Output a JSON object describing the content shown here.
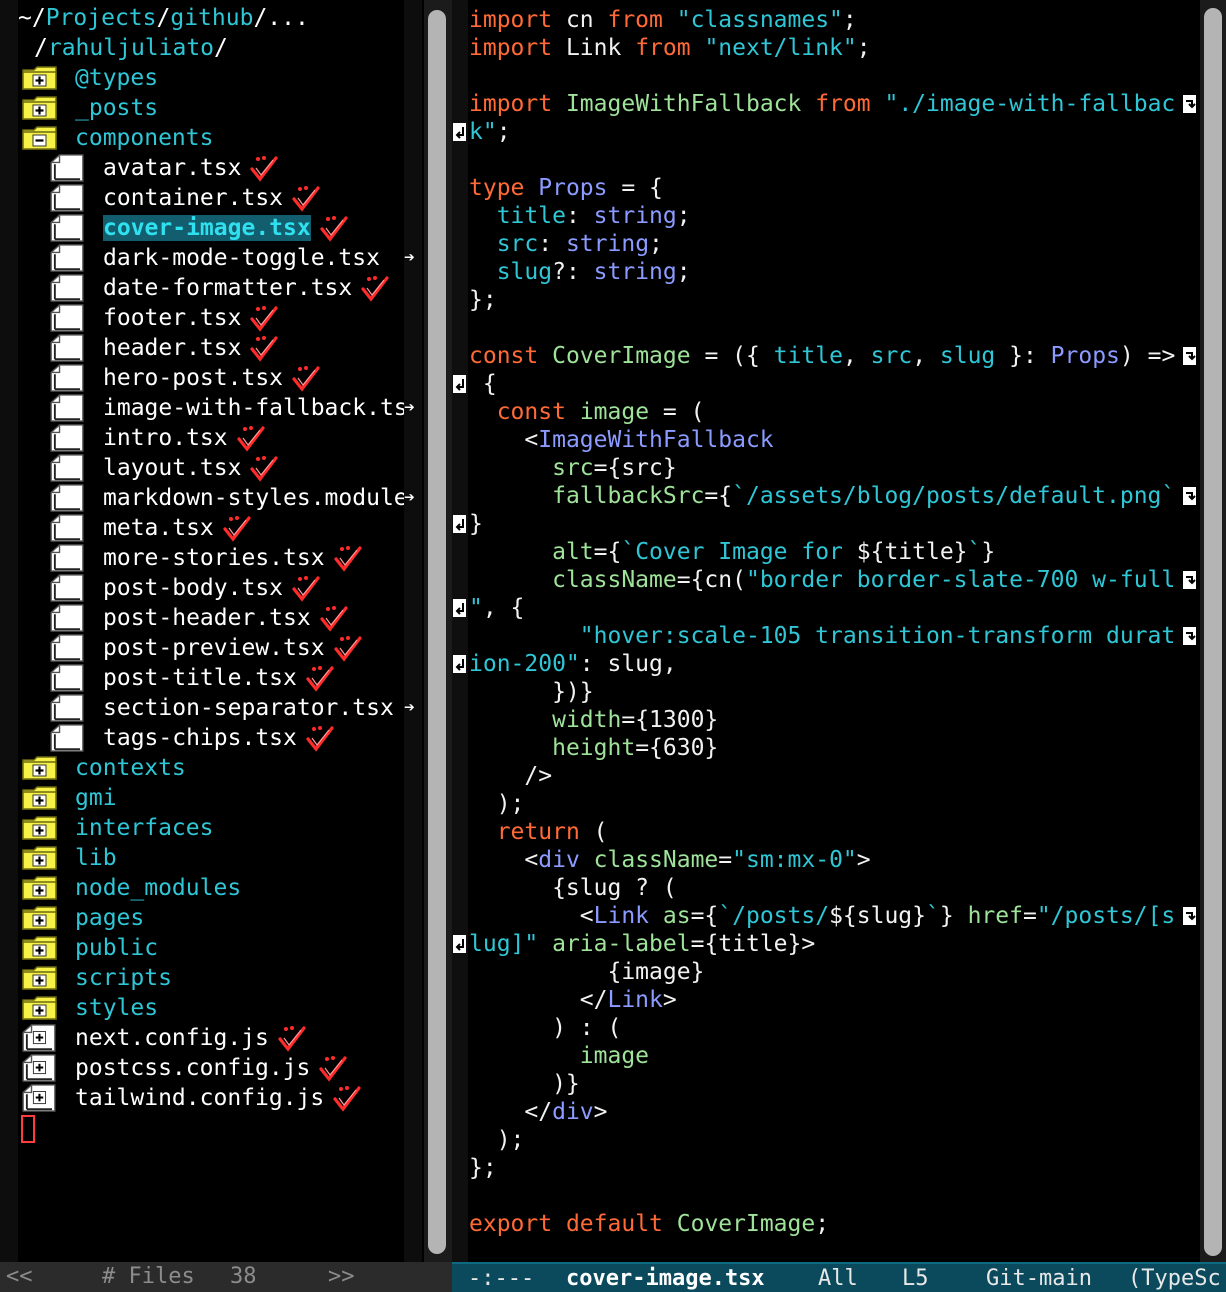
{
  "tree": {
    "path_line1": [
      "~/",
      "Projects",
      "/",
      "github",
      "/..."
    ],
    "path_line2": [
      "/",
      "rahuljuliato",
      "/"
    ],
    "top_dirs": [
      "@types",
      "_posts",
      "components"
    ],
    "component_files": [
      {
        "name": "avatar.tsx",
        "vc": true
      },
      {
        "name": "container.tsx",
        "vc": true
      },
      {
        "name": "cover-image.tsx",
        "vc": true,
        "selected": true
      },
      {
        "name": "dark-mode-toggle.tsx",
        "vc": false,
        "truncated": true
      },
      {
        "name": "date-formatter.tsx",
        "vc": true
      },
      {
        "name": "footer.tsx",
        "vc": true
      },
      {
        "name": "header.tsx",
        "vc": true
      },
      {
        "name": "hero-post.tsx",
        "vc": true
      },
      {
        "name": "image-with-fallback.ts",
        "vc": false,
        "truncated": true
      },
      {
        "name": "intro.tsx",
        "vc": true
      },
      {
        "name": "layout.tsx",
        "vc": true
      },
      {
        "name": "markdown-styles.module",
        "vc": false,
        "truncated": true
      },
      {
        "name": "meta.tsx",
        "vc": true
      },
      {
        "name": "more-stories.tsx",
        "vc": true
      },
      {
        "name": "post-body.tsx",
        "vc": true
      },
      {
        "name": "post-header.tsx",
        "vc": true
      },
      {
        "name": "post-preview.tsx",
        "vc": true
      },
      {
        "name": "post-title.tsx",
        "vc": true
      },
      {
        "name": "section-separator.tsx",
        "vc": false,
        "truncated": true
      },
      {
        "name": "tags-chips.tsx",
        "vc": true
      }
    ],
    "other_dirs": [
      "contexts",
      "gmi",
      "interfaces",
      "lib",
      "node_modules",
      "pages",
      "public",
      "scripts",
      "styles"
    ],
    "root_files": [
      "next.config.js",
      "postcss.config.js",
      "tailwind.config.js"
    ],
    "truncation_glyph": "➔"
  },
  "editor": {
    "lines": [
      [
        [
          "kw",
          "import"
        ],
        [
          "pn",
          " cn "
        ],
        [
          "kw",
          "from"
        ],
        [
          "pn",
          " "
        ],
        [
          "str",
          "\"classnames\""
        ],
        [
          "pn",
          ";"
        ]
      ],
      [
        [
          "kw",
          "import"
        ],
        [
          "pn",
          " Link "
        ],
        [
          "kw",
          "from"
        ],
        [
          "pn",
          " "
        ],
        [
          "str",
          "\"next/link\""
        ],
        [
          "pn",
          ";"
        ]
      ],
      [],
      [
        [
          "kw",
          "import"
        ],
        [
          "pn",
          " "
        ],
        [
          "id",
          "ImageWithFallback"
        ],
        [
          "pn",
          " "
        ],
        [
          "kw",
          "from"
        ],
        [
          "pn",
          " "
        ],
        [
          "str",
          "\"./image-with-fallbac"
        ]
      ],
      [
        [
          "str",
          "k\""
        ],
        [
          "pn",
          ";"
        ]
      ],
      [],
      [
        [
          "kw",
          "type"
        ],
        [
          "pn",
          " "
        ],
        [
          "ty",
          "Props"
        ],
        [
          "pn",
          " = {"
        ]
      ],
      [
        [
          "pn",
          "  "
        ],
        [
          "str",
          "title"
        ],
        [
          "pn",
          ": "
        ],
        [
          "ty",
          "string"
        ],
        [
          "pn",
          ";"
        ]
      ],
      [
        [
          "pn",
          "  "
        ],
        [
          "str",
          "src"
        ],
        [
          "pn",
          ": "
        ],
        [
          "ty",
          "string"
        ],
        [
          "pn",
          ";"
        ]
      ],
      [
        [
          "pn",
          "  "
        ],
        [
          "str",
          "slug"
        ],
        [
          "pn",
          "?: "
        ],
        [
          "ty",
          "string"
        ],
        [
          "pn",
          ";"
        ]
      ],
      [
        [
          "pn",
          "};"
        ]
      ],
      [],
      [
        [
          "kw",
          "const"
        ],
        [
          "pn",
          " "
        ],
        [
          "id",
          "CoverImage"
        ],
        [
          "pn",
          " = ({ "
        ],
        [
          "str",
          "title"
        ],
        [
          "pn",
          ", "
        ],
        [
          "str",
          "src"
        ],
        [
          "pn",
          ", "
        ],
        [
          "str",
          "slug"
        ],
        [
          "pn",
          " }: "
        ],
        [
          "ty",
          "Props"
        ],
        [
          "pn",
          ") =>"
        ]
      ],
      [
        [
          "pn",
          " {"
        ]
      ],
      [
        [
          "pn",
          "  "
        ],
        [
          "kw",
          "const"
        ],
        [
          "pn",
          " "
        ],
        [
          "id",
          "image"
        ],
        [
          "pn",
          " = ("
        ]
      ],
      [
        [
          "pn",
          "    <"
        ],
        [
          "cmp",
          "ImageWithFallback"
        ]
      ],
      [
        [
          "pn",
          "      "
        ],
        [
          "id",
          "src"
        ],
        [
          "pn",
          "={src}"
        ]
      ],
      [
        [
          "pn",
          "      "
        ],
        [
          "id",
          "fallbackSrc"
        ],
        [
          "pn",
          "={"
        ],
        [
          "str",
          "`/assets/blog/posts/default.png`"
        ]
      ],
      [
        [
          "pn",
          "}"
        ]
      ],
      [
        [
          "pn",
          "      "
        ],
        [
          "id",
          "alt"
        ],
        [
          "pn",
          "={"
        ],
        [
          "str",
          "`Cover Image for "
        ],
        [
          "pn",
          "${title}"
        ],
        [
          "str",
          "`"
        ],
        [
          "pn",
          "}"
        ]
      ],
      [
        [
          "pn",
          "      "
        ],
        [
          "id",
          "className"
        ],
        [
          "pn",
          "={cn("
        ],
        [
          "str",
          "\"border border-slate-700 w-full"
        ]
      ],
      [
        [
          "str",
          "\""
        ],
        [
          "pn",
          ", {"
        ]
      ],
      [
        [
          "pn",
          "        "
        ],
        [
          "str",
          "\"hover:scale-105 transition-transform durat"
        ]
      ],
      [
        [
          "str",
          "ion-200\""
        ],
        [
          "pn",
          ": slug,"
        ]
      ],
      [
        [
          "pn",
          "      })}"
        ]
      ],
      [
        [
          "pn",
          "      "
        ],
        [
          "id",
          "width"
        ],
        [
          "pn",
          "={1300}"
        ]
      ],
      [
        [
          "pn",
          "      "
        ],
        [
          "id",
          "height"
        ],
        [
          "pn",
          "={630}"
        ]
      ],
      [
        [
          "pn",
          "    />"
        ]
      ],
      [
        [
          "pn",
          "  );"
        ]
      ],
      [
        [
          "pn",
          "  "
        ],
        [
          "kw",
          "return"
        ],
        [
          "pn",
          " ("
        ]
      ],
      [
        [
          "pn",
          "    <"
        ],
        [
          "cmp",
          "div"
        ],
        [
          "pn",
          " "
        ],
        [
          "id",
          "className"
        ],
        [
          "pn",
          "="
        ],
        [
          "str",
          "\"sm:mx-0\""
        ],
        [
          "pn",
          ">"
        ]
      ],
      [
        [
          "pn",
          "      {slug ? ("
        ]
      ],
      [
        [
          "pn",
          "        <"
        ],
        [
          "cmp",
          "Link"
        ],
        [
          "pn",
          " "
        ],
        [
          "id",
          "as"
        ],
        [
          "pn",
          "={"
        ],
        [
          "str",
          "`/posts/"
        ],
        [
          "pn",
          "${slug}"
        ],
        [
          "str",
          "`"
        ],
        [
          "pn",
          "} "
        ],
        [
          "id",
          "href"
        ],
        [
          "pn",
          "="
        ],
        [
          "str",
          "\"/posts/[s"
        ]
      ],
      [
        [
          "str",
          "lug]\""
        ],
        [
          "pn",
          " "
        ],
        [
          "id",
          "aria-label"
        ],
        [
          "pn",
          "={title}>"
        ]
      ],
      [
        [
          "pn",
          "          {image}"
        ]
      ],
      [
        [
          "pn",
          "        </"
        ],
        [
          "cmp",
          "Link"
        ],
        [
          "pn",
          ">"
        ]
      ],
      [
        [
          "pn",
          "      ) : ("
        ]
      ],
      [
        [
          "pn",
          "        "
        ],
        [
          "id",
          "image"
        ]
      ],
      [
        [
          "pn",
          "      )}"
        ]
      ],
      [
        [
          "pn",
          "    </"
        ],
        [
          "cmp",
          "div"
        ],
        [
          "pn",
          ">"
        ]
      ],
      [
        [
          "pn",
          "  );"
        ]
      ],
      [
        [
          "pn",
          "};"
        ]
      ],
      [],
      [
        [
          "kw",
          "export"
        ],
        [
          "pn",
          " "
        ],
        [
          "kw",
          "default"
        ],
        [
          "pn",
          " "
        ],
        [
          "id",
          "CoverImage"
        ],
        [
          "pn",
          ";"
        ]
      ]
    ],
    "wrapped_right": [
      3,
      12,
      17,
      20,
      22,
      32
    ],
    "wrapped_left": [
      4,
      13,
      18,
      21,
      23,
      33
    ]
  },
  "modeline_left": {
    "prev": "<<",
    "label": "# Files",
    "count": "38",
    "next": ">>"
  },
  "modeline_right": {
    "status": "-:---",
    "buffer": "cover-image.tsx",
    "position": "All",
    "line": "L5",
    "vcs": "Git-main",
    "mode": "(TypeSc"
  },
  "colors": {
    "keyword": "#ff6a36",
    "string": "#2fc6d6",
    "type": "#8b9bff",
    "identifier": "#9fe29a",
    "folder": "#f7f247",
    "modeline_active": "#0b4a5c"
  }
}
